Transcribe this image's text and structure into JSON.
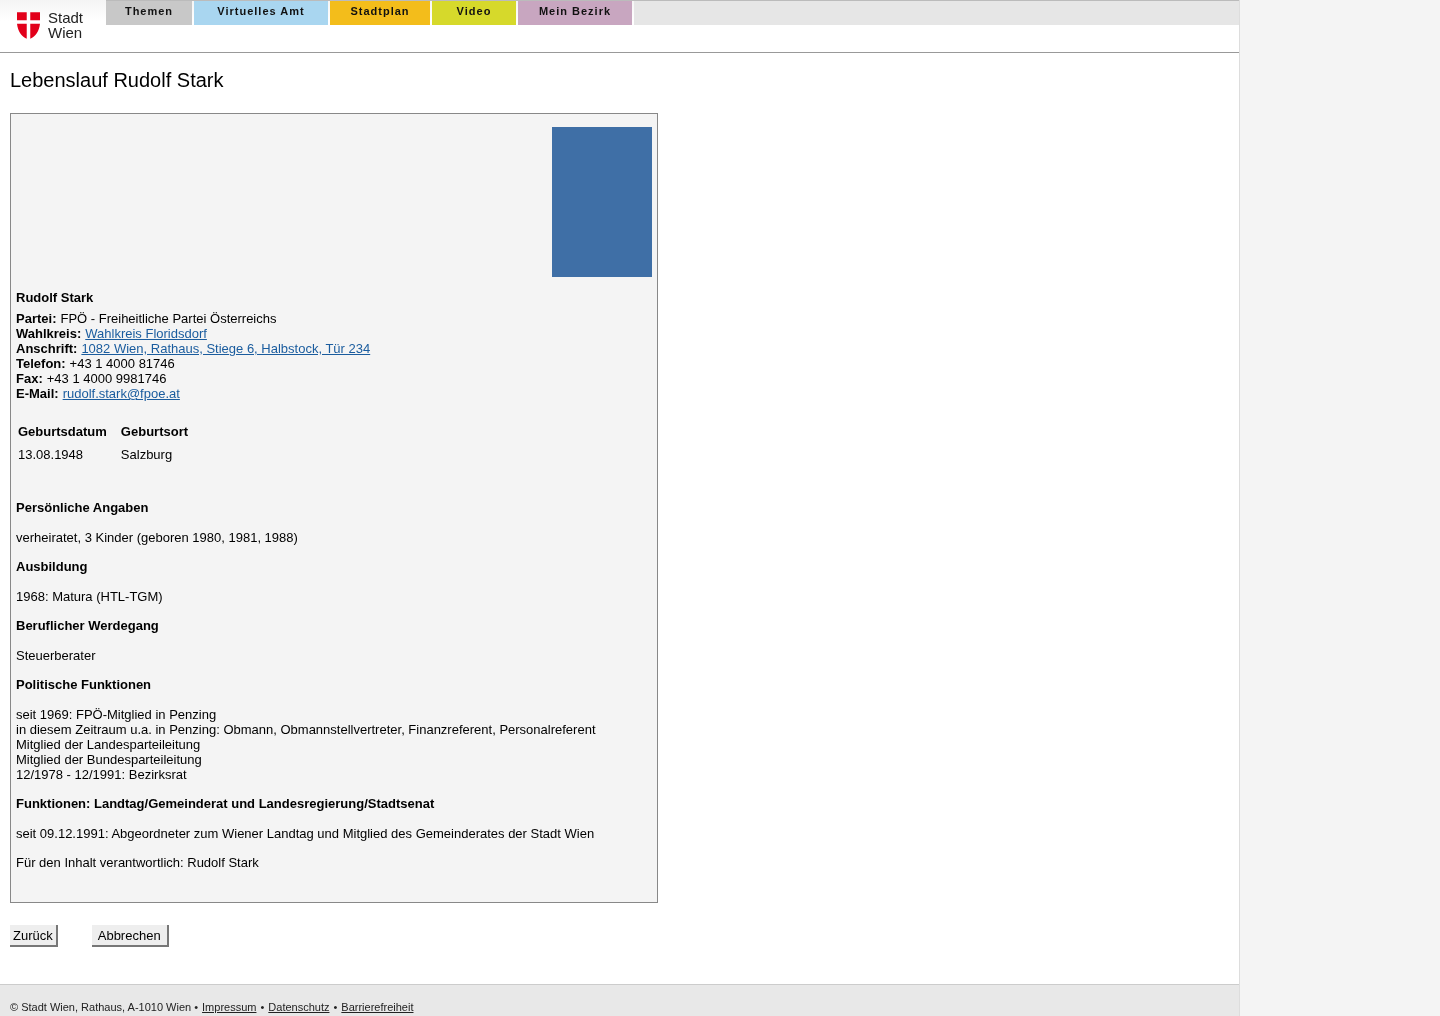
{
  "header": {
    "logo_text": [
      "Stadt",
      "Wien"
    ],
    "tabs": [
      {
        "label": "Themen",
        "color": "#c8c8c8"
      },
      {
        "label": "Virtuelles Amt",
        "color": "#a9d6f0"
      },
      {
        "label": "Stadtplan",
        "color": "#f3bd1b"
      },
      {
        "label": "Video",
        "color": "#d6d92b"
      },
      {
        "label": "Mein Bezirk",
        "color": "#c8a6c0"
      }
    ]
  },
  "page_title": "Lebenslauf Rudolf Stark",
  "profile": {
    "name": "Rudolf Stark",
    "details": [
      {
        "label": "Partei:",
        "value": "FPÖ - Freiheitliche Partei Österreichs",
        "kind": "text"
      },
      {
        "label": "Wahlkreis:",
        "value": "Wahlkreis Floridsdorf",
        "kind": "link"
      },
      {
        "label": "Anschrift:",
        "value": "1082 Wien, Rathaus, Stiege 6, Halbstock, Tür 234",
        "kind": "link"
      },
      {
        "label": "Telefon:",
        "value": "+43 1 4000 81746",
        "kind": "text"
      },
      {
        "label": "Fax:",
        "value": "+43 1 4000 9981746",
        "kind": "text"
      },
      {
        "label": "E-Mail:",
        "value": "rudolf.stark@fpoe.at",
        "kind": "link"
      }
    ],
    "birth_table": {
      "columns": [
        "Geburtsdatum",
        "Geburtsort"
      ],
      "rows": [
        [
          "13.08.1948",
          "Salzburg"
        ]
      ]
    },
    "sections": [
      {
        "heading": "Persönliche Angaben",
        "lines": [
          "verheiratet, 3 Kinder (geboren 1980, 1981, 1988)"
        ]
      },
      {
        "heading": "Ausbildung",
        "lines": [
          "1968: Matura (HTL-TGM)"
        ]
      },
      {
        "heading": "Beruflicher Werdegang",
        "lines": [
          "Steuerberater"
        ]
      },
      {
        "heading": "Politische Funktionen",
        "lines": [
          "seit 1969: FPÖ-Mitglied in Penzing",
          "in diesem Zeitraum u.a. in Penzing: Obmann, Obmannstellvertreter, Finanzreferent, Personalreferent",
          "Mitglied der Landesparteileitung",
          "Mitglied der Bundesparteileitung",
          "12/1978 - 12/1991: Bezirksrat"
        ]
      },
      {
        "heading": "Funktionen: Landtag/Gemeinderat und Landesregierung/Stadtsenat",
        "lines": [
          "seit 09.12.1991: Abgeordneter zum Wiener Landtag und Mitglied des Gemeinderates der Stadt Wien"
        ]
      }
    ],
    "responsible": "Für den Inhalt verantwortlich: Rudolf Stark"
  },
  "buttons": [
    "Zurück",
    "Abbrechen"
  ],
  "footer": [
    {
      "kind": "text",
      "text": "© Stadt Wien, Rathaus, A-1010 Wien •"
    },
    {
      "kind": "link",
      "text": "Impressum"
    },
    {
      "kind": "text",
      "text": "•"
    },
    {
      "kind": "link",
      "text": "Datenschutz"
    },
    {
      "kind": "text",
      "text": "•"
    },
    {
      "kind": "link",
      "text": "Barrierefreiheit"
    }
  ]
}
